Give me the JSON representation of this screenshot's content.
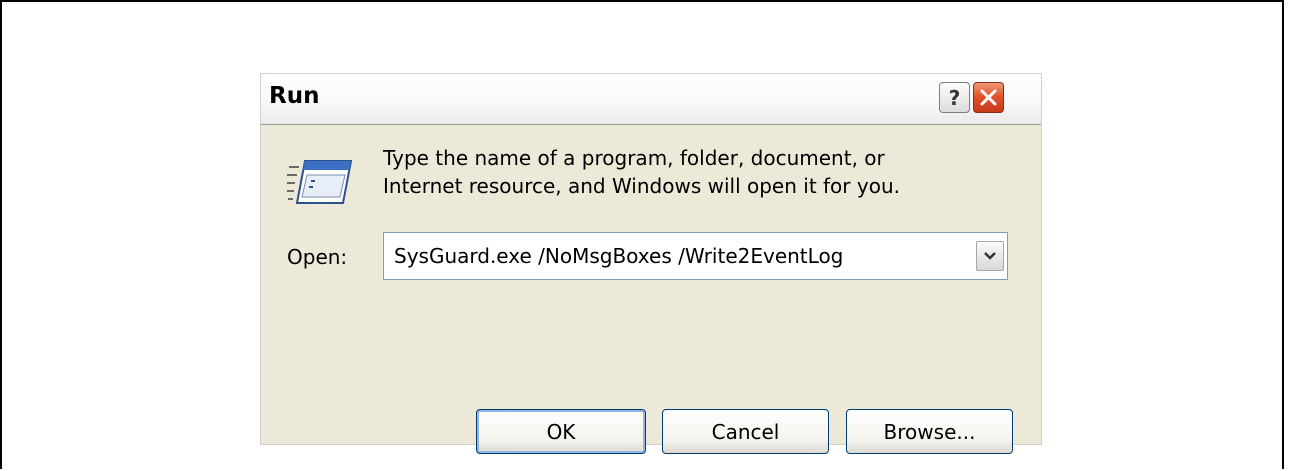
{
  "dialog": {
    "title": "Run",
    "help_glyph": "?",
    "icons": {
      "help": "help-icon",
      "close": "close-icon",
      "run": "run-program-icon",
      "dropdown": "chevron-down-icon"
    },
    "description_lines": [
      "Type the name of a program, folder, document, or",
      "Internet resource, and Windows will open it for you."
    ],
    "open_label": "Open:",
    "open_value": "SysGuard.exe /NoMsgBoxes /Write2EventLog",
    "buttons": {
      "ok_label": "OK",
      "cancel_label": "Cancel",
      "browse_label": "Browse..."
    }
  },
  "colors": {
    "dialog_background": "#ece9d8",
    "close_button": "#e0542c",
    "button_border": "#003c74",
    "input_border": "#7f9db9"
  }
}
